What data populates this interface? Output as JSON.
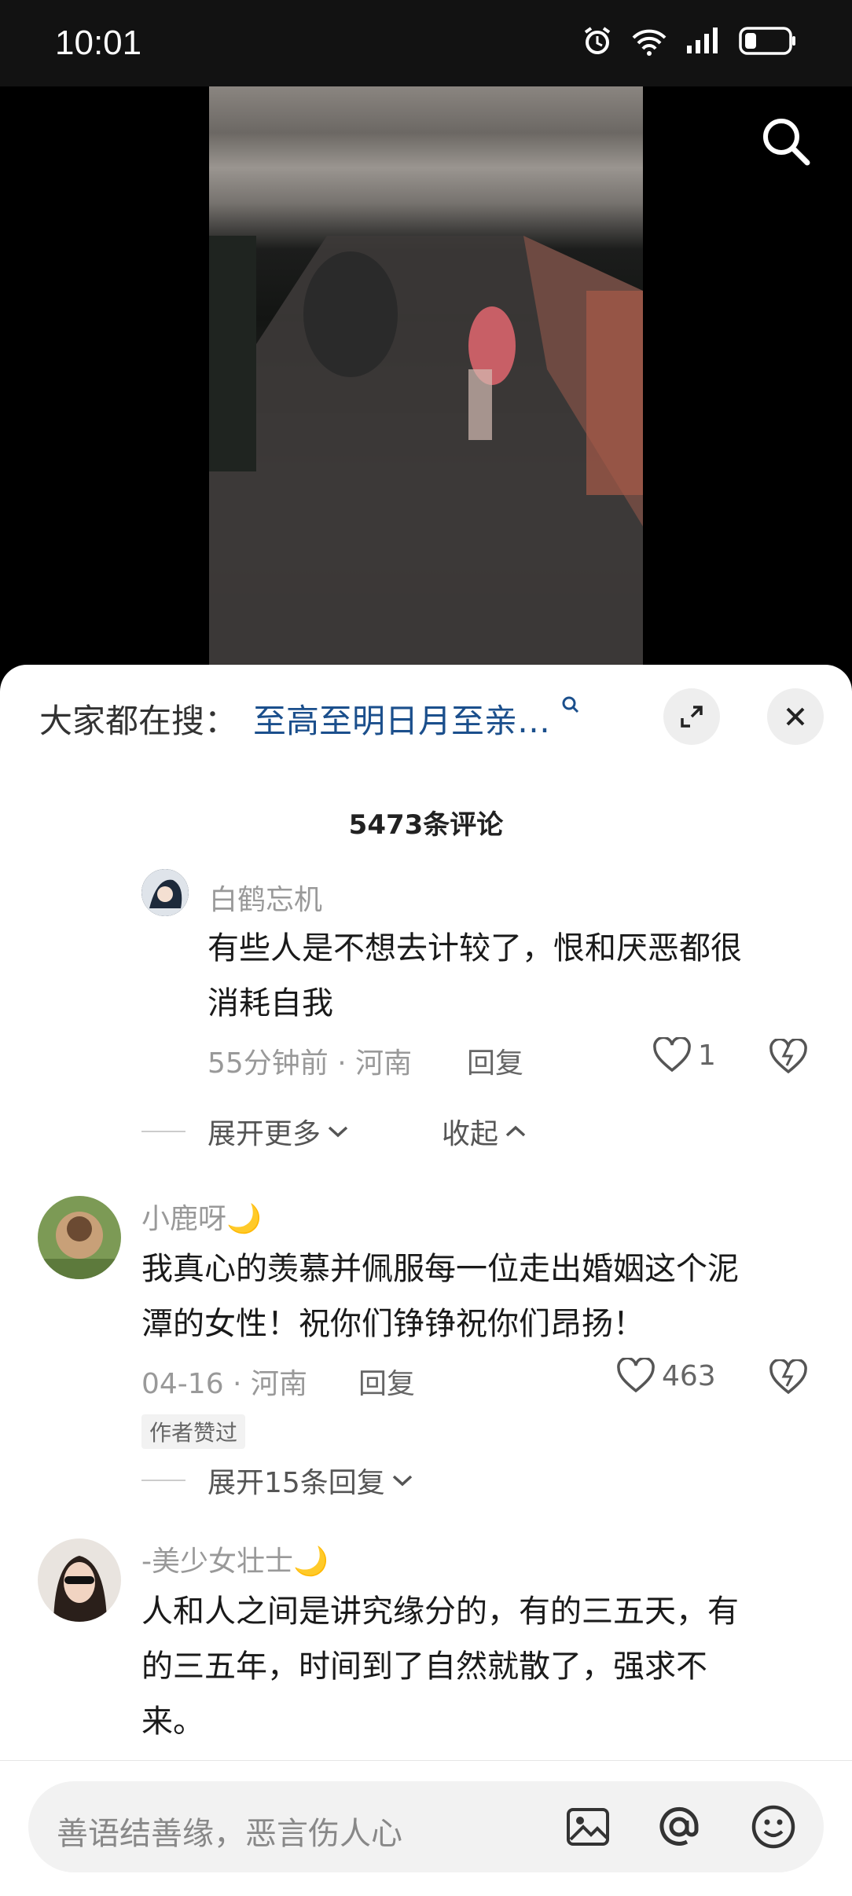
{
  "status_bar": {
    "time": "10:01"
  },
  "hot_search": {
    "prefix": "大家都在搜：",
    "query": "至高至明日月至亲…"
  },
  "comments_header": {
    "count_label": "5473条评论"
  },
  "comments": [
    {
      "name": "白鹤忘机",
      "text_lines": [
        "有些人是不想去计较了，恨和厌恶都很",
        "消耗自我"
      ],
      "time": "55分钟前",
      "location": "河南",
      "reply_label": "回复",
      "likes": "1",
      "expand_more": "展开更多",
      "collapse": "收起"
    },
    {
      "name": "小鹿呀🌙",
      "text_lines": [
        "我真心的羡慕并佩服每一位走出婚姻这个泥",
        "潭的女性！祝你们铮铮祝你们昂扬！"
      ],
      "time": "04-16",
      "location": "河南",
      "reply_label": "回复",
      "likes": "463",
      "badge": "作者赞过",
      "expand_replies": "展开15条回复"
    },
    {
      "name": "-美少女壮士🌙",
      "text_lines": [
        "人和人之间是讲究缘分的，有的三五天，有",
        "的三五年，时间到了自然就散了，强求不",
        "来。"
      ]
    }
  ],
  "input_bar": {
    "placeholder": "善语结善缘，恶言伤人心"
  },
  "icons": [
    "alarm-icon",
    "wifi-icon",
    "signal-icon",
    "battery-icon",
    "search-icon",
    "expand-icon",
    "close-icon",
    "heart-icon",
    "dislike-icon",
    "chevron-down-icon",
    "chevron-up-icon",
    "image-icon",
    "at-icon",
    "emoji-icon"
  ]
}
